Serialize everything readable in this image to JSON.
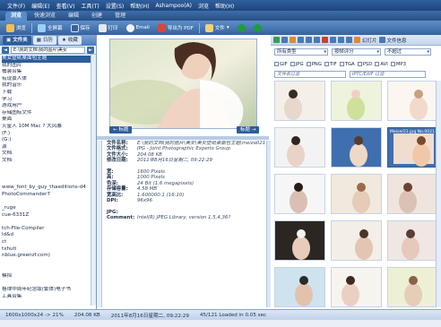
{
  "menubar": [
    "文件(F)",
    "编辑(E)",
    "查看(V)",
    "工具(T)",
    "设置(S)",
    "帮助(H)",
    "Ashampoo(A)",
    "浏览",
    "帮助(H)"
  ],
  "main_tabs": [
    {
      "label": "浏览",
      "active": true
    },
    {
      "label": "快速浏览",
      "active": false
    },
    {
      "label": "编辑",
      "active": false
    },
    {
      "label": "创建",
      "active": false
    },
    {
      "label": "管理",
      "active": false
    }
  ],
  "toolbar": {
    "browse": "浏览",
    "fullscreen": "全屏幕",
    "save": "保存",
    "print": "打印",
    "email": "Email",
    "export_pdf": "导出为 PDF",
    "file": "文件",
    "slideshow": "幻灯片",
    "file_info": "文件信息"
  },
  "left_tabs": {
    "folders": "文件夹",
    "calendar": "日历",
    "favorites": "收藏"
  },
  "path": "E:\\我的文档\\我的图片\\美女",
  "tree": [
    "美女壁纸桌面包主题",
    "我的图片",
    "桶装合集",
    "有现景人体",
    "我的音乐",
    "下载",
    "学习",
    "游戏用户",
    "存储图标文件",
    "桌面",
    "火星人 10M Mac ? 大风暴",
    "(F:)",
    "(G:)",
    "源",
    "文档",
    "文档",
    "",
    "",
    "",
    "www_font_by_guy_thaeditions-d4",
    "PhotoCommander7",
    "",
    "_ruge",
    "cue-6331Z",
    "",
    "tch-File-Compiler",
    "ld&d",
    "ct",
    "txhuti",
    "nblue.greenzf.com)",
    "",
    "",
    "模拟",
    "",
    "格律中周年纪念版(繁体)电子书",
    "工具合集"
  ],
  "preview_buttons": {
    "prev": "← 标题",
    "next": "标题 →"
  },
  "info": [
    {
      "label": "文件名称:",
      "value": "E:\\我的文档\\我的图片\\美女\\美女壁纸桌面包主题\\meiza021"
    },
    {
      "label": "文件格式:",
      "value": "JPG - Joint Photographic Experts Group"
    },
    {
      "label": "文件大小:",
      "value": "204.08 KB"
    },
    {
      "label": "修改日期:",
      "value": "2011年8月16日星期二, 09:22:29"
    },
    {
      "label": "",
      "value": ""
    },
    {
      "label": "宽:",
      "value": "1600 Pixels"
    },
    {
      "label": "高:",
      "value": "1000 Pixels"
    },
    {
      "label": "色深:",
      "value": "24 Bit (1.6 megapixels)"
    },
    {
      "label": "存储容量:",
      "value": "4.58 MB"
    },
    {
      "label": "宽高比:",
      "value": "1.600000:1 (16:10)"
    },
    {
      "label": "DPI:",
      "value": "96x96"
    },
    {
      "label": "",
      "value": ""
    },
    {
      "label": "JPG:",
      "value": ""
    },
    {
      "label": "Comment:",
      "value": "Intel(R) JPEG Library, version 1,5,4,36?"
    }
  ],
  "right_toolbar": {
    "slideshow": "幻灯片",
    "file_info": "文件信息"
  },
  "filters": {
    "type": "所有类型",
    "rating": "按帧评分",
    "size": "不超过",
    "formats": [
      "GIF",
      "JPG",
      "PNG",
      "TIF",
      "TGA",
      "PSD",
      "AVI",
      "MP3"
    ],
    "name_filter": "文件名过滤",
    "iptc_filter": "IPTC/EXIF 过滤"
  },
  "selected_thumb_caption": "Meise/21.jpg  No.0021",
  "status": {
    "dims": "1600x1000x24 -> 21%",
    "size": "204.08 KB",
    "date": "2011年8月16日星期二, 09:22:29",
    "loaded": "45/121 Loaded in 0.05 sec"
  },
  "colors": {
    "accent": "#2c5c9b",
    "toolbar": "#34629d"
  }
}
